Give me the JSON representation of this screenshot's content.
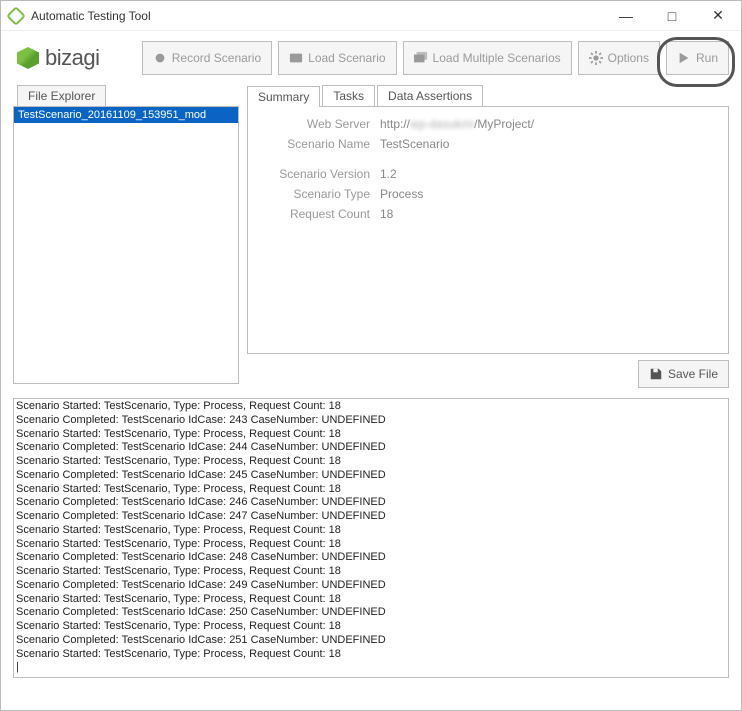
{
  "window": {
    "title": "Automatic Testing Tool"
  },
  "logo": {
    "text": "bizagi"
  },
  "toolbar": {
    "record": "Record Scenario",
    "load": "Load Scenario",
    "load_multiple": "Load Multiple Scenarios",
    "options": "Options",
    "run": "Run"
  },
  "file_explorer": {
    "tab": "File Explorer",
    "items": [
      "TestScenario_20161109_153951_mod"
    ]
  },
  "main": {
    "tabs": {
      "summary": "Summary",
      "tasks": "Tasks",
      "assertions": "Data Assertions"
    },
    "summary": {
      "webserver_label": "Web Server",
      "webserver_prefix": "http://",
      "webserver_host_blur": "wp-dasukmi",
      "webserver_suffix": "/MyProject/",
      "scenario_name_label": "Scenario Name",
      "scenario_name": "TestScenario",
      "scenario_version_label": "Scenario Version",
      "scenario_version": "1.2",
      "scenario_type_label": "Scenario Type",
      "scenario_type": "Process",
      "request_count_label": "Request Count",
      "request_count": "18"
    }
  },
  "save_button": "Save File",
  "log": {
    "lines": [
      "Scenario Started: TestScenario, Type: Process, Request Count: 18",
      "Scenario Completed: TestScenario IdCase: 243 CaseNumber: UNDEFINED",
      "Scenario Started: TestScenario, Type: Process, Request Count: 18",
      "Scenario Completed: TestScenario IdCase: 244 CaseNumber: UNDEFINED",
      "Scenario Started: TestScenario, Type: Process, Request Count: 18",
      "Scenario Completed: TestScenario IdCase: 245 CaseNumber: UNDEFINED",
      "Scenario Started: TestScenario, Type: Process, Request Count: 18",
      "Scenario Completed: TestScenario IdCase: 246 CaseNumber: UNDEFINED",
      "Scenario Completed: TestScenario IdCase: 247 CaseNumber: UNDEFINED",
      "Scenario Started: TestScenario, Type: Process, Request Count: 18",
      "Scenario Started: TestScenario, Type: Process, Request Count: 18",
      "Scenario Completed: TestScenario IdCase: 248 CaseNumber: UNDEFINED",
      "Scenario Started: TestScenario, Type: Process, Request Count: 18",
      "Scenario Completed: TestScenario IdCase: 249 CaseNumber: UNDEFINED",
      "Scenario Started: TestScenario, Type: Process, Request Count: 18",
      "Scenario Completed: TestScenario IdCase: 250 CaseNumber: UNDEFINED",
      "Scenario Started: TestScenario, Type: Process, Request Count: 18",
      "Scenario Completed: TestScenario IdCase: 251 CaseNumber: UNDEFINED",
      "Scenario Started: TestScenario, Type: Process, Request Count: 18",
      "|"
    ]
  }
}
